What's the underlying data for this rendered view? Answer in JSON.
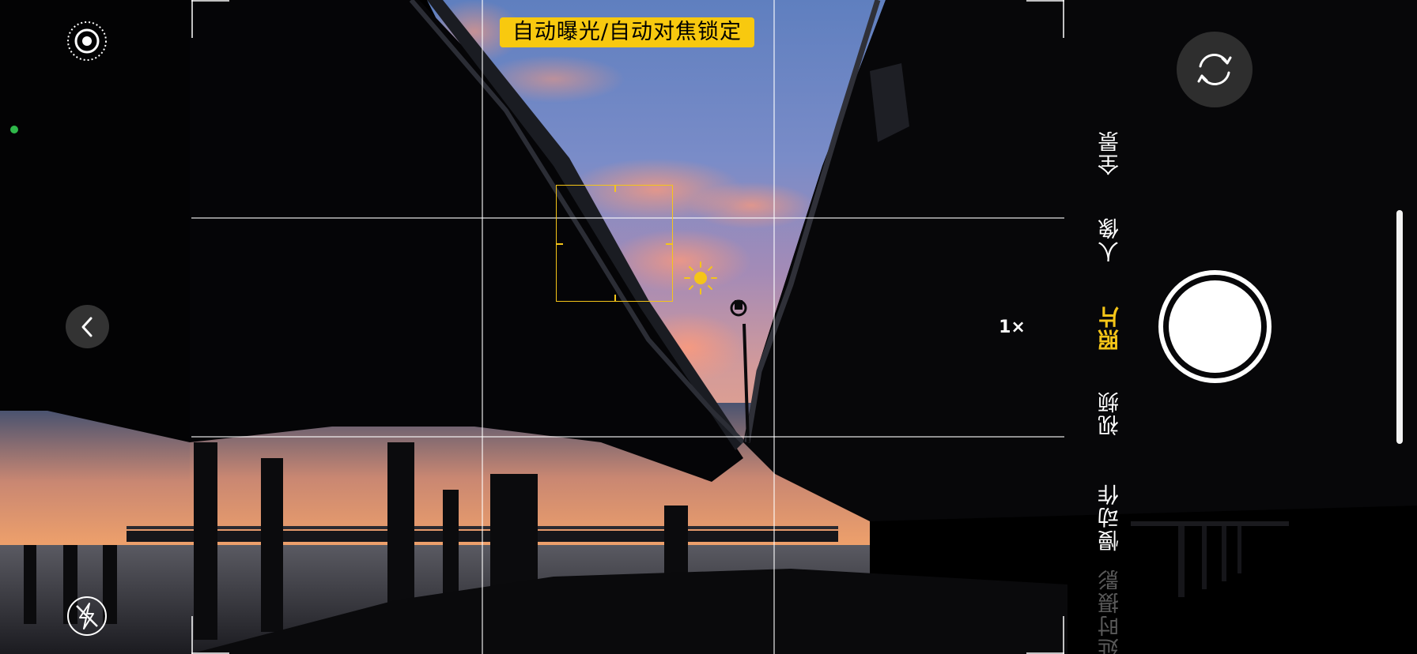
{
  "viewfinder": {
    "ae_af_lock_label": "自动曝光/自动对焦锁定",
    "zoom_label": "1×"
  },
  "modes": [
    {
      "label": "全景",
      "active": false
    },
    {
      "label": "人像",
      "active": false
    },
    {
      "label": "照片",
      "active": true
    },
    {
      "label": "视频",
      "active": false
    },
    {
      "label": "慢动作",
      "active": false
    },
    {
      "label": "延时摄影",
      "active": false
    }
  ],
  "icons": {
    "live_photo": "live-photo-icon",
    "back": "chevron-left-icon",
    "flash": "flash-off-icon",
    "switch_camera": "switch-camera-icon",
    "exposure": "sun-icon",
    "indicator": "green-dot"
  },
  "colors": {
    "accent": "#f5c518",
    "badge": "#f8c90f",
    "indicator": "#2fb84a"
  }
}
